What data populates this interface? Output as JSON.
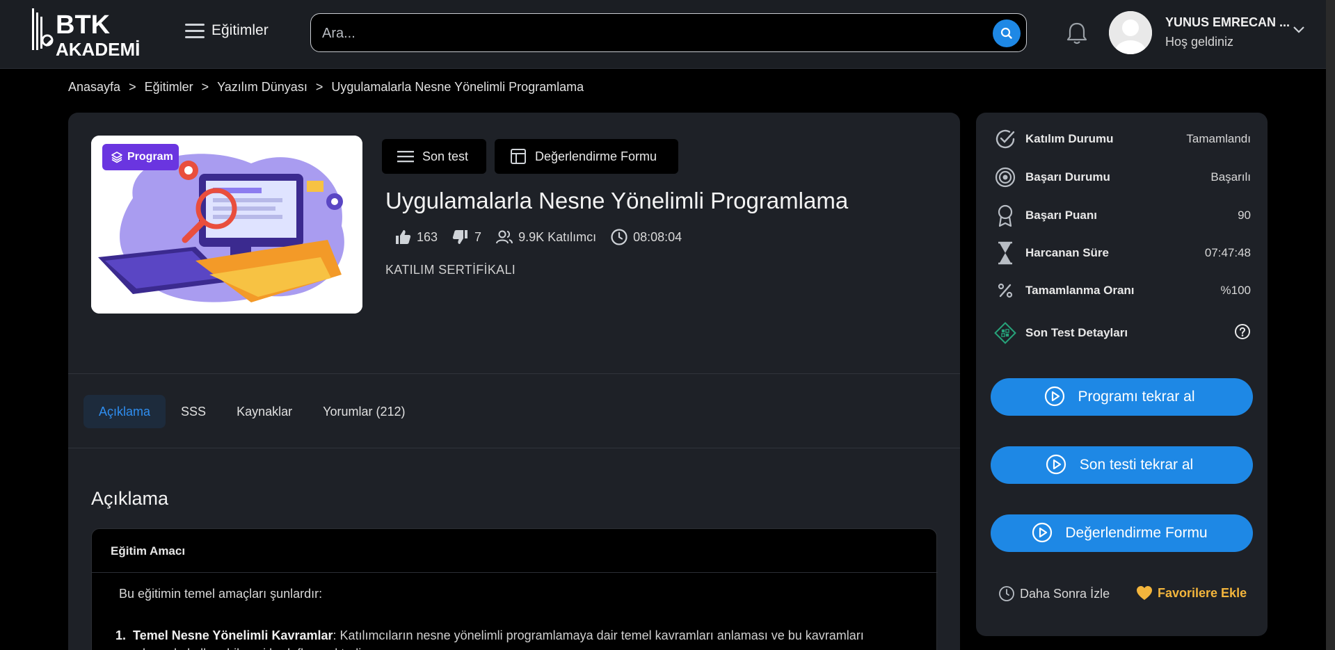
{
  "header": {
    "logo_text": "BTK AKADEMİ",
    "menu_label": "Eğitimler",
    "search_placeholder": "Ara...",
    "user_name": "YUNUS EMRECAN ...",
    "user_greeting": "Hoş geldiniz"
  },
  "breadcrumb": [
    "Anasayfa",
    "Eğitimler",
    "Yazılım Dünyası",
    "Uygulamalarla Nesne Yönelimli Programlama"
  ],
  "course": {
    "badge": "Program",
    "buttons": {
      "last_test": "Son test",
      "evaluation_form": "Değerlendirme Formu"
    },
    "title": "Uygulamalarla Nesne Yönelimli Programlama",
    "likes": "163",
    "dislikes": "7",
    "participants": "9.9K Katılımcı",
    "duration": "08:08:04",
    "certificate": "KATILIM SERTİFİKALI"
  },
  "tabs": [
    {
      "label": "Açıklama",
      "active": true
    },
    {
      "label": "SSS"
    },
    {
      "label": "Kaynaklar"
    },
    {
      "label": "Yorumlar (212)"
    }
  ],
  "description": {
    "section_title": "Açıklama",
    "box_title": "Eğitim Amacı",
    "intro": "Bu eğitimin temel amaçları şunlardır:",
    "item_number": "1.",
    "item_title": "Temel Nesne Yönelimli Kavramlar",
    "item_text": ": Katılımcıların nesne yönelimli programlamaya dair temel kavramları anlaması ve bu kavramları uygulamada kullanabilmesi hedeflenmektedir."
  },
  "sidebar": {
    "rows": [
      {
        "icon": "check-circle-icon",
        "label": "Katılım Durumu",
        "value": "Tamamlandı"
      },
      {
        "icon": "target-icon",
        "label": "Başarı Durumu",
        "value": "Başarılı"
      },
      {
        "icon": "award-ribbon-icon",
        "label": "Başarı Puanı",
        "value": "90"
      },
      {
        "icon": "hourglass-icon",
        "label": "Harcanan Süre",
        "value": "07:47:48"
      },
      {
        "icon": "percent-icon",
        "label": "Tamamlanma Oranı",
        "value": "%100"
      },
      {
        "icon": "quiz-diamond-icon",
        "label": "Son Test Detayları",
        "value": ""
      }
    ],
    "buttons": [
      "Programı tekrar al",
      "Son testi tekrar al",
      "Değerlendirme Formu"
    ],
    "watch_later": "Daha Sonra İzle",
    "favorite": "Favorilere Ekle"
  },
  "colors": {
    "accent_blue": "#1e88e5",
    "badge_purple": "#6a35e0",
    "favorite_gold": "#f3b53c",
    "page_bg": "#000000",
    "card_bg": "#1e2127",
    "header_bg": "#1b1e23"
  }
}
